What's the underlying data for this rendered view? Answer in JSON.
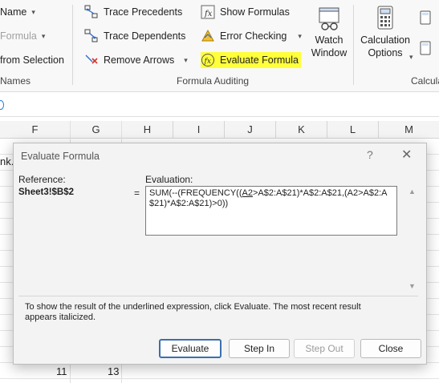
{
  "ribbon": {
    "left_col": {
      "name_label": "Name",
      "formula_label": "Formula",
      "from_selection": "from Selection",
      "group": "Names"
    },
    "trace_precedents": "Trace Precedents",
    "trace_dependents": "Trace Dependents",
    "remove_arrows": "Remove Arrows",
    "show_formulas": "Show Formulas",
    "error_checking": "Error Checking",
    "evaluate_formula": "Evaluate Formula",
    "watch_window": "Watch\nWindow",
    "calc_options": "Calculation\nOptions",
    "group_formula_auditing": "Formula Auditing",
    "group_calculation": "Calcula"
  },
  "grid": {
    "columns": [
      "F",
      "G",
      "H",
      "I",
      "J",
      "K",
      "L",
      "M"
    ],
    "left_cell_text": "nk.",
    "row_values": [
      "11",
      "13"
    ]
  },
  "dialog": {
    "title": "Evaluate Formula",
    "help": "?",
    "close_glyph": "✕",
    "reference_label": "Reference:",
    "reference_value": "Sheet3!$B$2",
    "equals": "=",
    "evaluation_label": "Evaluation:",
    "formula_before": "SUM(--(FREQUENCY((",
    "formula_underlined": "A2",
    "formula_after": ">A$2:A$21)*A$2:A$21,(A2>A$2:A$21)*A$2:A$21)>0))",
    "info": "To show the result of the underlined expression, click Evaluate.  The most recent result appears italicized.",
    "buttons": {
      "evaluate": "Evaluate",
      "step_in": "Step In",
      "step_out": "Step Out",
      "close": "Close"
    }
  }
}
